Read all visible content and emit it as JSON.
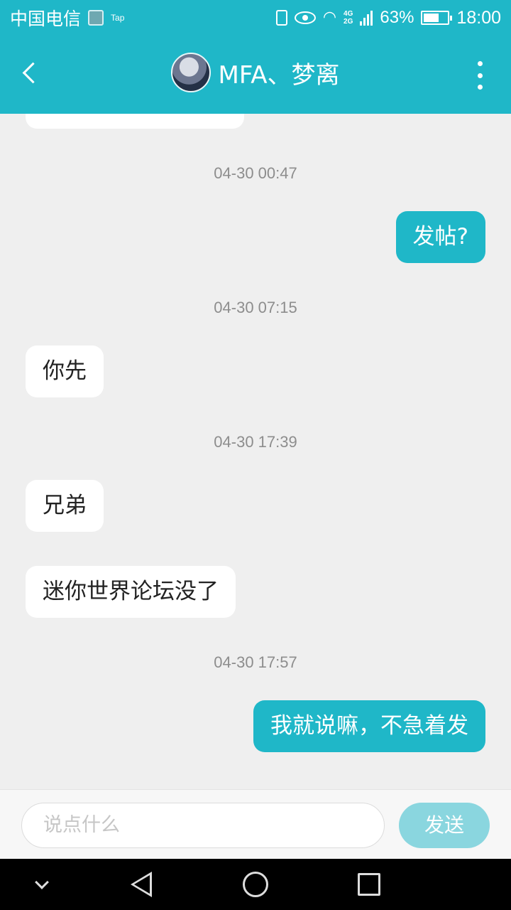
{
  "status_bar": {
    "carrier": "中国电信",
    "tap_label": "Tap",
    "net_top": "4G",
    "net_bottom": "2G",
    "battery_percent": "63%",
    "battery_level": 0.63,
    "time": "18:00"
  },
  "header": {
    "title": "MFA、梦离"
  },
  "messages": [
    {
      "type": "in",
      "text": ""
    },
    {
      "type": "time",
      "text": "04-30 00:47"
    },
    {
      "type": "out",
      "text": "发帖?"
    },
    {
      "type": "time",
      "text": "04-30 07:15"
    },
    {
      "type": "in",
      "text": "你先"
    },
    {
      "type": "time",
      "text": "04-30 17:39"
    },
    {
      "type": "in",
      "text": "兄弟"
    },
    {
      "type": "in",
      "text": "迷你世界论坛没了"
    },
    {
      "type": "time",
      "text": "04-30 17:57"
    },
    {
      "type": "out",
      "text": "我就说嘛，不急着发"
    }
  ],
  "input": {
    "placeholder": "说点什么",
    "send_label": "发送"
  },
  "colors": {
    "accent": "#1fb7c8",
    "send_disabled": "#8ad6df",
    "background": "#efefef"
  }
}
